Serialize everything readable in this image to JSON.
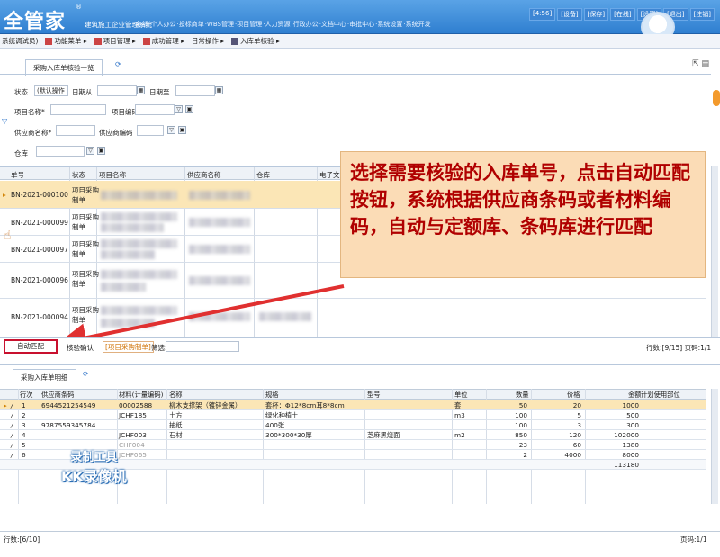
{
  "header": {
    "logo": "全管家",
    "logo_reg": "®",
    "system_name": "建筑施工企业管理系统",
    "nav": [
      "·全部",
      "·个人办公",
      "·投标商单",
      "·WBS管理",
      "·项目管理",
      "·人力资源",
      "·行政办公",
      "·文档中心",
      "·审批中心",
      "·系统设置",
      "·系统开发"
    ],
    "links": [
      "[4:56]",
      "[设备]",
      "[保存]",
      "[在线]",
      "[设置]",
      "[退出]",
      "[注销]"
    ]
  },
  "breadcrumb": {
    "user": "系统调试员)",
    "items": [
      "功能菜单 ▸",
      "项目管理 ▸",
      "成功管理 ▸",
      "日常操作 ▸",
      "入库单核验 ▸"
    ]
  },
  "panel1": {
    "tab_label": "采购入库单核验一览",
    "filters": {
      "status_label": "状态",
      "status_value": "(默认操作",
      "date_from_label": "日期从",
      "date_to_label": "日期至",
      "project_name_label": "项目名称*",
      "project_code_label": "项目编码",
      "supplier_name_label": "供应商名称*",
      "supplier_code_label": "供应商编码",
      "warehouse_label": "仓库"
    },
    "columns": [
      "单号",
      "状态",
      "项目名称",
      "供应商名称",
      "仓库",
      "电子文"
    ],
    "rows": [
      {
        "no": "BN-2021-000100",
        "status1": "项目采购",
        "status2": "制单"
      },
      {
        "no": "BN-2021-000099",
        "status1": "项目采购",
        "status2": "制单"
      },
      {
        "no": "BN-2021-000097",
        "status1": "项目采购",
        "status2": "制单"
      },
      {
        "no": "BN-2021-000096",
        "status1": "项目采购",
        "status2": "制单"
      },
      {
        "no": "BN-2021-000094",
        "status1": "项目采购",
        "status2": "制单"
      }
    ],
    "bottom": {
      "auto_match": "自动匹配",
      "verify_confirm": "核验确认",
      "filter_tag": "[项目采购制单]",
      "filter_label": "筛选:",
      "row_stat": "行数:[9/15] 页码:1/1"
    }
  },
  "callout": "选择需要核验的入库单号，点击自动匹配按钮，系统根据供应商条码或者材料编码，自动与定额库、条码库进行匹配",
  "panel2": {
    "tab_label": "采购入库单明细",
    "columns": [
      "行次",
      "供应商条码",
      "材料(计量编码)",
      "名称",
      "规格",
      "型号",
      "单位",
      "数量",
      "价格",
      "金额",
      "计划使用部位"
    ],
    "rows": [
      {
        "n": "1",
        "barcode": "6944521254549",
        "code": "00002588",
        "name": "柳木支撑架（镀锌金属）",
        "spec": "套杯：Φ12*8cm耳8*8cm",
        "model": "",
        "unit": "套",
        "qty": "50",
        "price": "20",
        "amount": "1000"
      },
      {
        "n": "2",
        "barcode": "",
        "code": "JCHF185",
        "name": "土方",
        "spec": "绿化种植土",
        "model": "",
        "unit": "m3",
        "qty": "100",
        "price": "5",
        "amount": "500"
      },
      {
        "n": "3",
        "barcode": "9787559345784",
        "code": "",
        "name": "抽纸",
        "spec": "400张",
        "model": "",
        "unit": "",
        "qty": "100",
        "price": "3",
        "amount": "300"
      },
      {
        "n": "4",
        "barcode": "",
        "code": "JCHF003",
        "name": "石材",
        "spec": "300*300*30厚",
        "model": "芝麻黑烧面",
        "unit": "m2",
        "qty": "850",
        "price": "120",
        "amount": "102000"
      },
      {
        "n": "5",
        "barcode": "",
        "code": "CHF004",
        "name": "",
        "spec": "",
        "model": "",
        "unit": "",
        "qty": "23",
        "price": "60",
        "amount": "1380"
      },
      {
        "n": "6",
        "barcode": "",
        "code": "JCHF065",
        "name": "",
        "spec": "",
        "model": "",
        "unit": "",
        "qty": "2",
        "price": "4000",
        "amount": "8000"
      }
    ],
    "total": "113180",
    "footer_rows": "行数:[6/10]",
    "footer_page": "页码:1/1"
  },
  "watermark": {
    "line1": "录制工具",
    "line2": "KK录像机"
  },
  "colors": {
    "accent": "#2f7fd0",
    "selected_row": "#fbe6b6",
    "callout_bg": "#fbdcb6",
    "callout_text": "#b00000",
    "arrow": "#e03030"
  }
}
